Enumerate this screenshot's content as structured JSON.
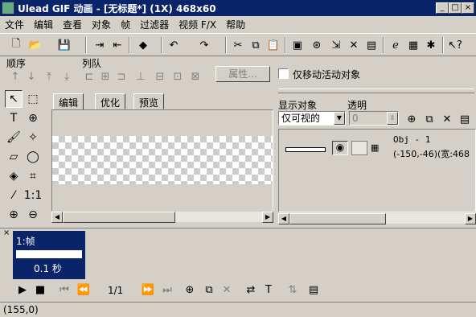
{
  "window": {
    "title": "Ulead GIF 动画 - [无标题*] (1X) 468x60",
    "controls": [
      "_",
      "□",
      "×"
    ]
  },
  "menu": [
    "文件",
    "编辑",
    "查看",
    "对象",
    "帧",
    "过滤器",
    "视频 F/X",
    "帮助"
  ],
  "row2": {
    "order_label": "顺序",
    "queue_label": "列队",
    "properties_button": "属性...",
    "move_active_only": "仅移动活动对象"
  },
  "editor": {
    "tabs": [
      "编辑",
      "优化",
      "预览"
    ]
  },
  "objects": {
    "show_label": "显示对象",
    "transparency_label": "透明",
    "show_value": "仅可视的",
    "transparency_value": "0",
    "obj_name": "Obj - 1",
    "obj_info": "(-150,-46)(宽:468"
  },
  "frames": {
    "frame_label": "1:帧",
    "frame_delay": "0.1 秒",
    "page_counter": "1/1"
  },
  "status": {
    "coords": "(155,0)"
  }
}
